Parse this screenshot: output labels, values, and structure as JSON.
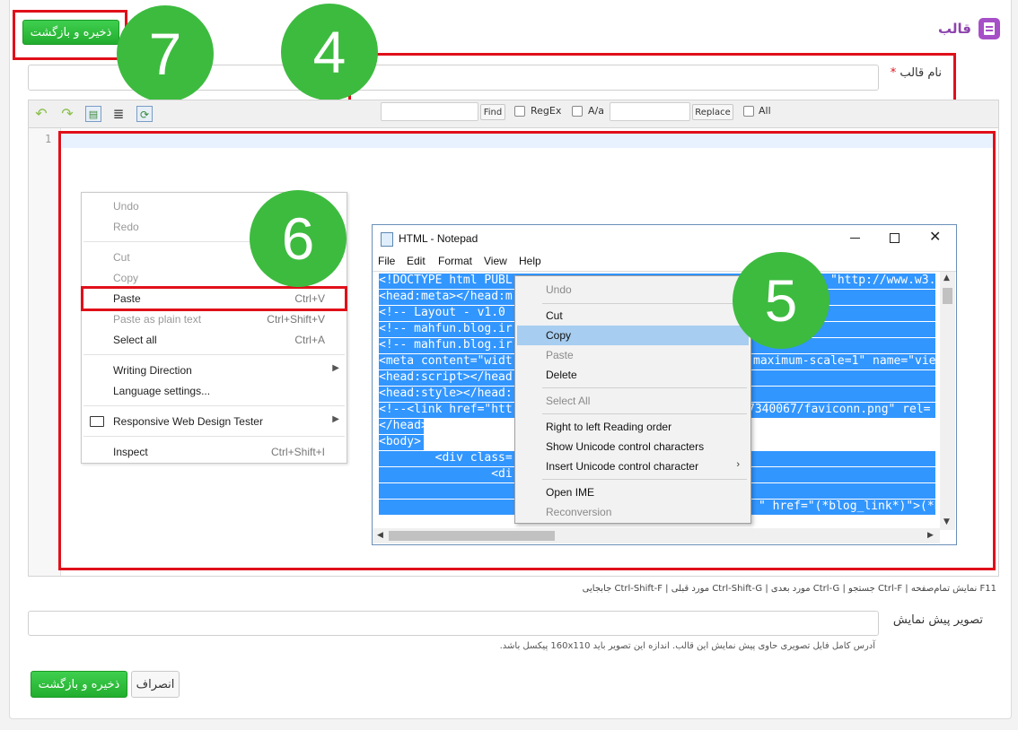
{
  "header": {
    "title": "قالب",
    "save_back_top": "ذخیره و بازگشت"
  },
  "form": {
    "name_label": "نام قالب",
    "required_mark": "*",
    "preview_label": "تصویر پیش نمایش",
    "preview_hint": "آدرس کامل فایل تصویری حاوی پیش نمایش این قالب. اندازه این تصویر باید 160x110 پیکسل باشد.",
    "shortcuts": "F11 نمایش تمام‌صفحه | Ctrl-F جستجو | Ctrl-G مورد بعدی | Ctrl-Shift-G مورد قبلی | Ctrl-Shift-F جابجایی",
    "save_back_bottom": "ذخیره و بازگشت",
    "cancel": "انصراف"
  },
  "toolbar": {
    "find_btn": "Find",
    "regex_label": "RegEx",
    "case_label": "A/a",
    "replace_btn": "Replace",
    "all_label": "All",
    "line_number": "1"
  },
  "annotations": {
    "n7": "7",
    "n4": "4",
    "n6": "6",
    "n5": "5"
  },
  "browser_menu": {
    "undo": "Undo",
    "redo": "Redo",
    "cut": "Cut",
    "copy": "Copy",
    "paste": "Paste",
    "paste_sc": "Ctrl+V",
    "paste_plain": "Paste as plain text",
    "paste_plain_sc": "Ctrl+Shift+V",
    "select_all": "Select all",
    "select_all_sc": "Ctrl+A",
    "writing_direction": "Writing Direction",
    "language_settings": "Language settings...",
    "rwd_tester": "Responsive Web Design Tester",
    "inspect": "Inspect",
    "inspect_sc": "Ctrl+Shift+I"
  },
  "notepad": {
    "title": "HTML - Notepad",
    "menus": [
      "File",
      "Edit",
      "Format",
      "View",
      "Help"
    ],
    "lines": [
      "<!DOCTYPE html PUBL",
      "<head:meta></head:m",
      "<!-- Layout - v1.0",
      "<!-- mahfun.blog.ir",
      "<!-- mahfun.blog.ir",
      "<meta content=\"widt",
      "<head:script></head",
      "<head:style></head:",
      "<!--<link href=\"htt",
      "</head>",
      "<body>",
      "        <div class=",
      "                <di"
    ],
    "right_lines": [
      "\"http://www.w3.o",
      "maximum-scale=1\" name=\"vie",
      "7340067/faviconn.png\" rel=",
      "\" href=\"(*blog_link*)\">(*b"
    ]
  },
  "notepad_menu": {
    "undo": "Undo",
    "cut": "Cut",
    "copy": "Copy",
    "paste": "Paste",
    "delete": "Delete",
    "select_all": "Select All",
    "rtl": "Right to left Reading order",
    "show_unicode": "Show Unicode control characters",
    "insert_unicode": "Insert Unicode control character",
    "open_ime": "Open IME",
    "reconversion": "Reconversion"
  },
  "colors": {
    "green": "#3dbb3f",
    "red": "#e0101a",
    "selection": "#3296ff",
    "purple": "#8e44ad"
  }
}
